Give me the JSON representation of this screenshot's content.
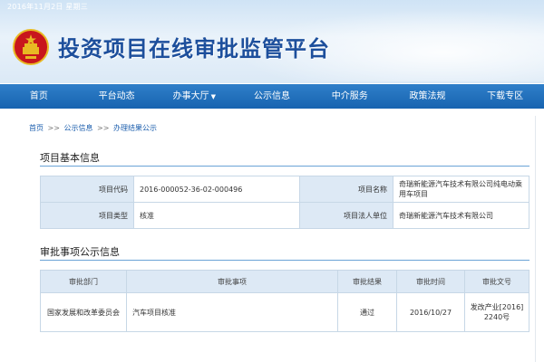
{
  "header": {
    "date": "2016年11月2日 星期三",
    "title": "投资项目在线审批监管平台",
    "emblem_icon": "national-emblem-icon"
  },
  "nav": {
    "items": [
      "首页",
      "平台动态",
      "办事大厅",
      "公示信息",
      "中介服务",
      "政策法规",
      "下载专区"
    ],
    "dropdown_caret": "▼"
  },
  "breadcrumb": {
    "items": [
      "首页",
      "公示信息",
      "办理结果公示"
    ],
    "separator": ">>"
  },
  "basic_info": {
    "title": "项目基本信息",
    "rows": [
      {
        "label1": "项目代码",
        "value1": "2016-000052-36-02-000496",
        "label2": "项目名称",
        "value2": "奇瑞新能源汽车技术有限公司纯电动乘用车项目"
      },
      {
        "label1": "项目类型",
        "value1": "核准",
        "label2": "项目法人单位",
        "value2": "奇瑞新能源汽车技术有限公司"
      }
    ]
  },
  "approval": {
    "title": "审批事项公示信息",
    "headers": [
      "审批部门",
      "审批事项",
      "审批结果",
      "审批时间",
      "审批文号"
    ],
    "rows": [
      [
        "国家发展和改革委员会",
        "汽车项目核准",
        "通过",
        "2016/10/27",
        "发改产业[2016] 2240号"
      ]
    ]
  },
  "colors": {
    "nav_bg": "#1763b0",
    "title_color": "#1d4f9c",
    "label_bg": "#dde9f5"
  }
}
